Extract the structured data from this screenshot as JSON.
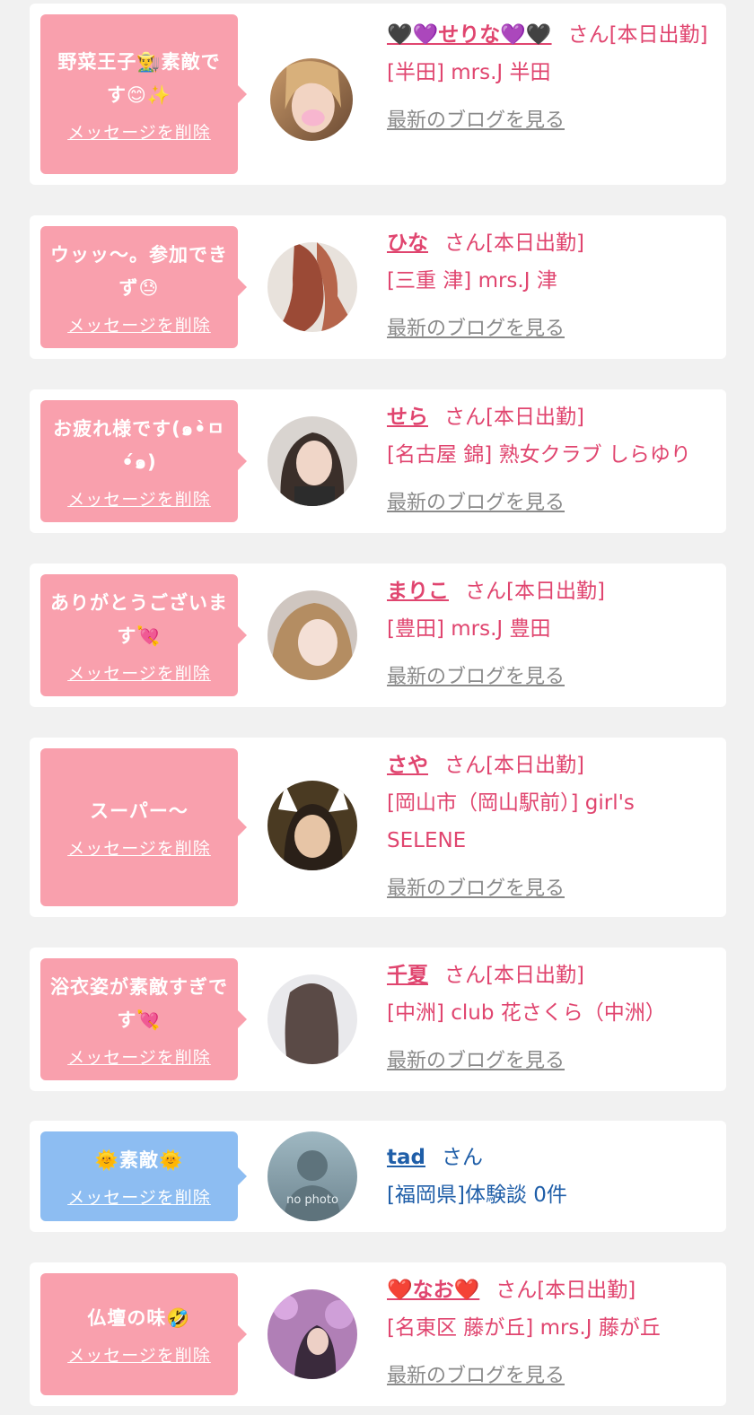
{
  "colors": {
    "pink_bubble": "#f9a0ad",
    "blue_bubble": "#8dbdf2",
    "pink_text": "#e0456f",
    "blue_text": "#1f5ea8",
    "link_gray": "#8a8a8a"
  },
  "delete_label": "メッセージを削除",
  "blog_label": "最新のブログを見る",
  "items": [
    {
      "message": "野菜王子👨‍🌾素敵です😊✨",
      "name": "🖤💜せりな💜🖤",
      "suffix": "さん[本日出勤]",
      "shop": "[半田] mrs.J 半田",
      "blog": "最新のブログを見る"
    },
    {
      "message": "ウッッ〜。参加できず😓",
      "name": "ひな",
      "suffix": "さん[本日出勤]",
      "shop": "[三重 津] mrs.J 津",
      "blog": "最新のブログを見る"
    },
    {
      "message": "お疲れ様です(๑•̀ㅁ•́๑)",
      "name": "せら",
      "suffix": "さん[本日出勤]",
      "shop": "[名古屋 錦] 熟女クラブ しらゆり",
      "blog": "最新のブログを見る"
    },
    {
      "message": "ありがとうございます💘",
      "name": "まりこ",
      "suffix": "さん[本日出勤]",
      "shop": "[豊田] mrs.J 豊田",
      "blog": "最新のブログを見る"
    },
    {
      "message": "スーパー〜",
      "name": "さや",
      "suffix": "さん[本日出勤]",
      "shop": "[岡山市（岡山駅前）] girl's SELENE",
      "blog": "最新のブログを見る"
    },
    {
      "message": "浴衣姿が素敵すぎです💘",
      "name": "千夏",
      "suffix": "さん[本日出勤]",
      "shop": "[中洲] club 花さくら（中洲）",
      "blog": "最新のブログを見る"
    },
    {
      "message": "🌞素敵🌞",
      "name": "tad",
      "suffix": "さん",
      "shop": "[福岡県]体験談 0件",
      "avatar_label": "no photo"
    },
    {
      "message": "仏壇の味🤣",
      "name": "❤️なお❤️",
      "suffix": "さん[本日出勤]",
      "shop": "[名東区 藤が丘] mrs.J 藤が丘",
      "blog": "最新のブログを見る"
    }
  ]
}
